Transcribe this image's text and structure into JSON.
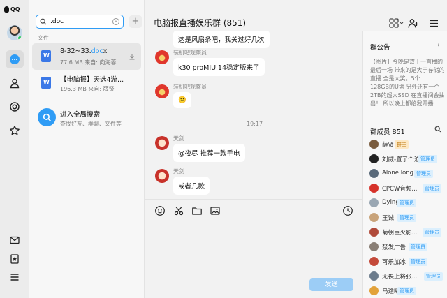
{
  "app": {
    "brand": "QQ"
  },
  "sessions": {
    "search": {
      "value": ".doc"
    },
    "section_label": "文件",
    "files": [
      {
        "name_prefix": "8-32~33.",
        "name_match": "doc",
        "name_suffix": "x",
        "meta": "77.6 MB 来自: 向海蓉"
      },
      {
        "name_prefix": "【电脑报】天选4游...",
        "name_match": "",
        "name_suffix": "",
        "meta": "196.3 MB 来自: 薛贤"
      }
    ],
    "global_search": {
      "title": "进入全局搜索",
      "subtitle": "查找好友、群聊、文件等"
    }
  },
  "chat": {
    "title": "电脑报直播娱乐群 (851)",
    "messages": [
      {
        "sender": "",
        "text": "这是风扇条吧，我关过好几次"
      },
      {
        "sender": "装机吧观察员",
        "text": "k30 proMIUI14稳定版来了"
      },
      {
        "sender": "装机吧观察员",
        "text": "🙂"
      },
      {
        "sender": "天剑",
        "text": "@夜尽 推荐一款手电"
      },
      {
        "sender": "天剑",
        "text": "或者几款"
      }
    ],
    "time_divider": "19:17",
    "send_label": "发送"
  },
  "right_panel": {
    "notice_title": "群公告",
    "notice_lines": [
      "【图片】今晚是双十一直播的",
      "最后一场 带来的是大于存储的",
      "直播 全是大奖。5个",
      "128GB的U盘 另外还有一个",
      "2TB的超大SSD 在直播间会抽",
      "出！ 所以晚上都给我开播..."
    ],
    "members_title": "群成员 851",
    "members": [
      {
        "name": "薛贤",
        "badge": "群主",
        "badge_type": "owner",
        "color": "#7a5c3e"
      },
      {
        "name": "刘威-置了个泣",
        "badge": "管理员",
        "badge_type": "admin",
        "color": "#222222"
      },
      {
        "name": "Alone long ...",
        "badge": "管理员",
        "badge_type": "admin",
        "color": "#5a6a7a"
      },
      {
        "name": "CPCW音频...",
        "badge": "管理员",
        "badge_type": "admin",
        "color": "#d6322a"
      },
      {
        "name": "Dying",
        "badge": "管理员",
        "badge_type": "admin",
        "color": "#9aa7b3"
      },
      {
        "name": "王诚",
        "badge": "管理员",
        "badge_type": "admin",
        "color": "#c8a37a"
      },
      {
        "name": "菊朝臣火影...",
        "badge": "管理员",
        "badge_type": "admin",
        "color": "#b04a3a"
      },
      {
        "name": "禁发广告",
        "badge": "管理员",
        "badge_type": "admin",
        "color": "#8a7f76"
      },
      {
        "name": "可乐加冰",
        "badge": "管理员",
        "badge_type": "admin",
        "color": "#c44a3a"
      },
      {
        "name": "无畏上将张...",
        "badge": "管理员",
        "badge_type": "admin",
        "color": "#6b7b8b"
      },
      {
        "name": "马逾曦",
        "badge": "管理员",
        "badge_type": "admin",
        "color": "#e2a23a"
      }
    ]
  }
}
